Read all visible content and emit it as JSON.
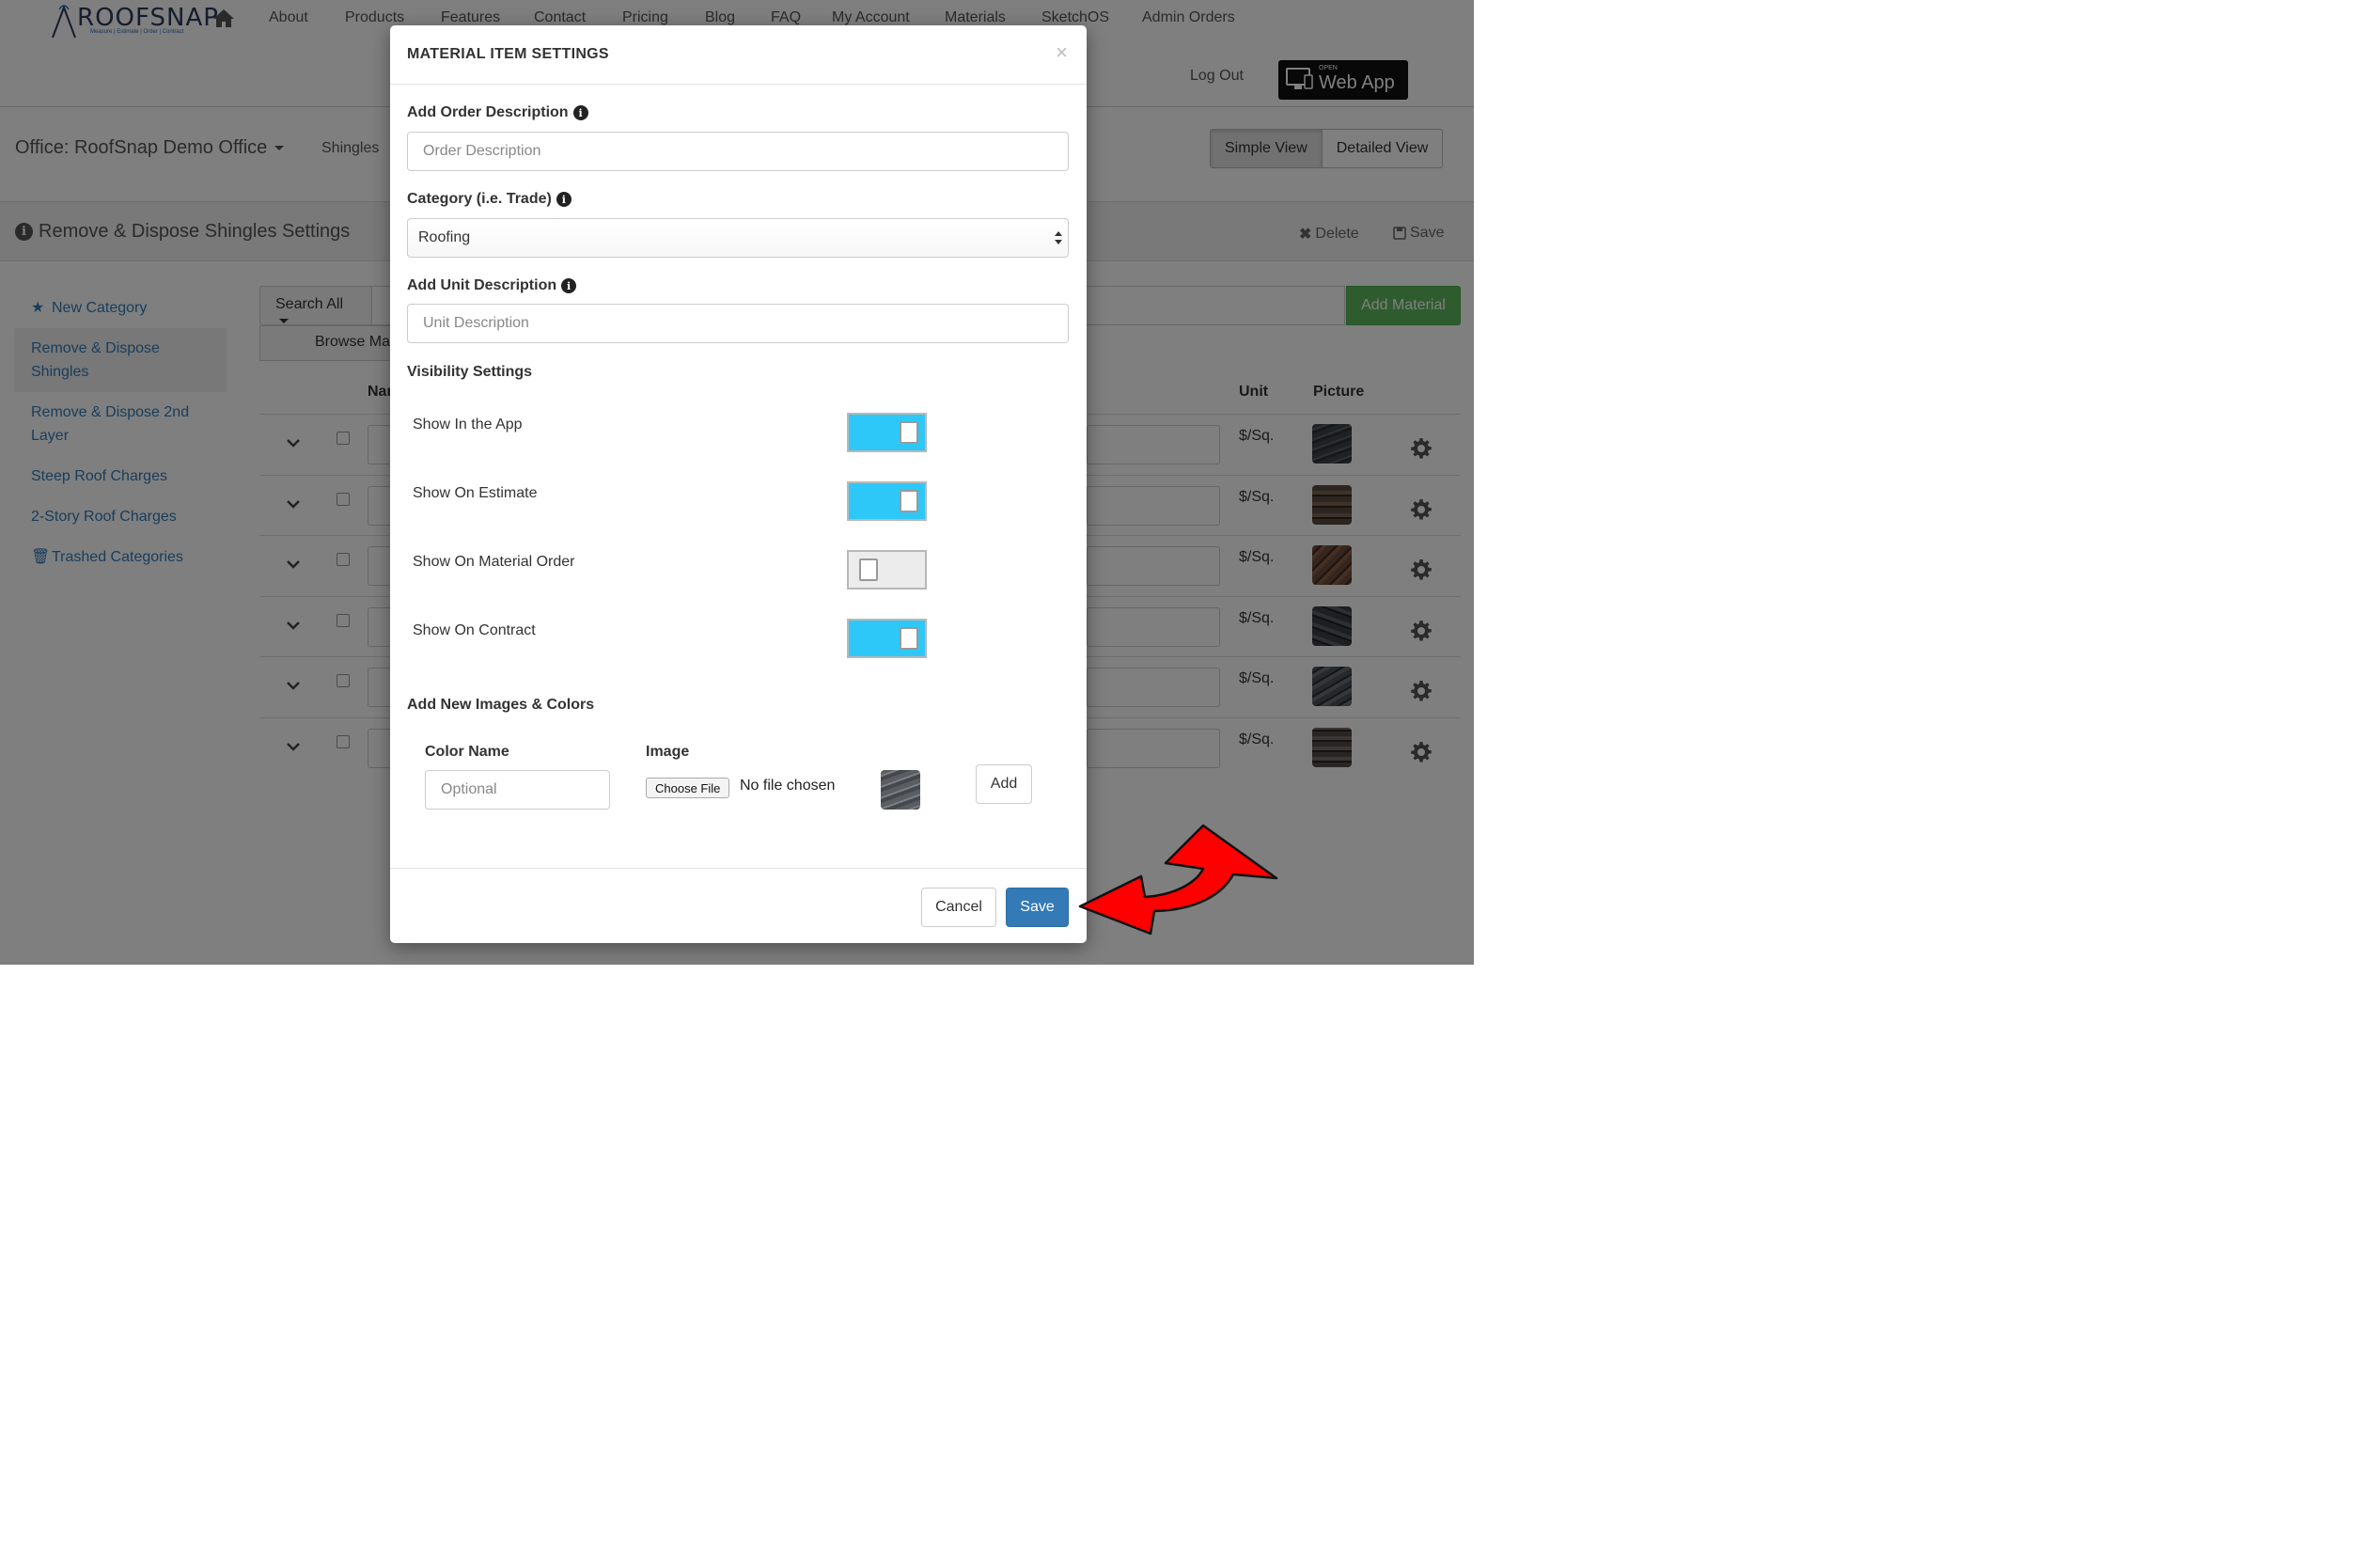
{
  "brand": {
    "name": "ROOFSNAP",
    "tagline": "Measure | Estimate | Order | Contract"
  },
  "nav": {
    "items": [
      "About",
      "Products",
      "Features",
      "Contact",
      "Pricing",
      "Blog",
      "FAQ",
      "My Account",
      "Materials",
      "SketchOS",
      "Admin Orders"
    ],
    "logout": "Log Out",
    "webapp_open": "OPEN",
    "webapp_label": "Web App"
  },
  "office": {
    "title": "Office: RoofSnap Demo Office",
    "tab": "Shingles",
    "views": {
      "simple": "Simple View",
      "detailed": "Detailed View"
    }
  },
  "settings_bar": {
    "title": "Remove & Dispose Shingles Settings",
    "delete": "Delete",
    "save": "Save"
  },
  "sidebar": {
    "items": [
      {
        "label": "New Category",
        "icon": "star-icon"
      },
      {
        "label": "Remove & Dispose Shingles",
        "active": true
      },
      {
        "label": "Remove & Dispose 2nd Layer"
      },
      {
        "label": "Steep Roof Charges"
      },
      {
        "label": "2-Story Roof Charges"
      },
      {
        "label": "Trashed Categories",
        "icon": "trash-icon"
      }
    ]
  },
  "toolbar": {
    "search_all": "Search All",
    "browse": "Browse Materials",
    "add_material": "Add Material"
  },
  "table": {
    "headers": {
      "name": "Name",
      "unit": "Unit",
      "picture": "Picture"
    },
    "rows": [
      {
        "unit": "$/Sq.",
        "pic_color": "#4a4f55"
      },
      {
        "unit": "$/Sq.",
        "pic_color": "#5a4a3e"
      },
      {
        "unit": "$/Sq.",
        "pic_color": "#6b4a3a"
      },
      {
        "unit": "$/Sq.",
        "pic_color": "#3c3f44"
      },
      {
        "unit": "$/Sq.",
        "pic_color": "#4b5058"
      },
      {
        "unit": "$/Sq.",
        "pic_color": "#524b46"
      }
    ]
  },
  "modal": {
    "title": "MATERIAL ITEM SETTINGS",
    "close": "×",
    "order_description": {
      "label": "Add Order Description",
      "placeholder": "Order Description"
    },
    "category": {
      "label": "Category (i.e. Trade)",
      "value": "Roofing"
    },
    "unit_description": {
      "label": "Add Unit Description",
      "placeholder": "Unit Description"
    },
    "visibility": {
      "heading": "Visibility Settings",
      "items": [
        {
          "label": "Show In the App",
          "on": true
        },
        {
          "label": "Show On Estimate",
          "on": true
        },
        {
          "label": "Show On Material Order",
          "on": false
        },
        {
          "label": "Show On Contract",
          "on": true
        }
      ]
    },
    "images": {
      "heading": "Add New Images & Colors",
      "color_name_label": "Color Name",
      "color_name_placeholder": "Optional",
      "image_label": "Image",
      "choose_file": "Choose File",
      "no_file": "No file chosen",
      "add": "Add"
    },
    "footer": {
      "cancel": "Cancel",
      "save": "Save"
    }
  },
  "colors": {
    "toggle_on": "#2ec8f8",
    "save_button": "#337ab7",
    "add_material": "#5cb85c",
    "link": "#337ab7",
    "annotation_arrow": "#ff0000"
  }
}
